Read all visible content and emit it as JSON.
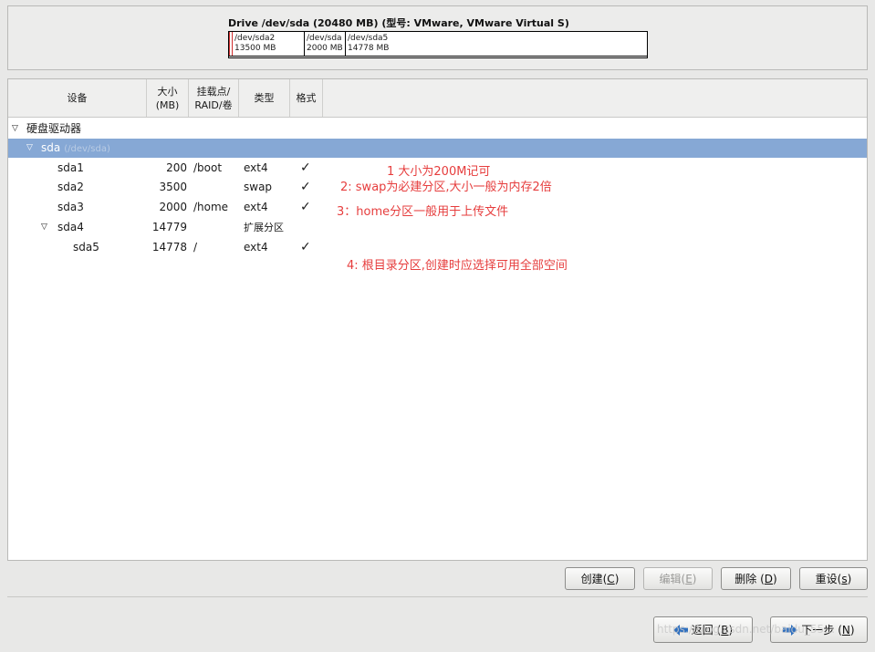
{
  "drive": {
    "title": "Drive /dev/sda (20480 MB) (型号: VMware, VMware Virtual S)",
    "segments": [
      {
        "name": "/dev/sda2",
        "size": "3500 MB",
        "prefix": "1"
      },
      {
        "name": "/dev/sda",
        "size": "2000 MB"
      },
      {
        "name": "/dev/sda5",
        "size": "14778 MB"
      }
    ]
  },
  "table": {
    "headers": {
      "device": "设备",
      "size": "大小\n(MB)",
      "mount": "挂载点/\nRAID/卷",
      "type": "类型",
      "format": "格式"
    },
    "group": "硬盘驱动器",
    "disk": {
      "name": "sda",
      "path": "(/dev/sda)"
    },
    "rows": [
      {
        "device": "sda1",
        "size": "200",
        "mount": "/boot",
        "type": "ext4",
        "format": "✓"
      },
      {
        "device": "sda2",
        "size": "3500",
        "mount": "",
        "type": "swap",
        "format": "✓"
      },
      {
        "device": "sda3",
        "size": "2000",
        "mount": "/home",
        "type": "ext4",
        "format": "✓"
      },
      {
        "device": "sda4",
        "size": "14779",
        "mount": "",
        "type": "扩展分区",
        "format": ""
      },
      {
        "device": "sda5",
        "size": "14778",
        "mount": "/",
        "type": "ext4",
        "format": "✓"
      }
    ]
  },
  "annotations": [
    "1 大小为200M记可",
    "2: swap为必建分区,大小一般为内存2倍",
    "3：home分区一般用于上传文件",
    "4: 根目录分区,创建时应选择可用全部空间"
  ],
  "buttons": {
    "create": {
      "label": "创建(",
      "key": "C",
      "suffix": ")"
    },
    "edit": {
      "label": "编辑(",
      "key": "E",
      "suffix": ")"
    },
    "delete": {
      "label": "删除 (",
      "key": "D",
      "suffix": ")"
    },
    "reset": {
      "label": "重设(",
      "key": "s",
      "suffix": ")"
    },
    "back": {
      "label": "返回 (",
      "key": "B",
      "suffix": ")"
    },
    "next": {
      "label": "下一步 (",
      "key": "N",
      "suffix": ")"
    }
  },
  "watermark": "https://blog.csdn.net/baidu_55…",
  "colors": {
    "selected_row": "#86a8d5",
    "annotation": "#e63d3d",
    "sda1_marker": "#d12e2e"
  }
}
